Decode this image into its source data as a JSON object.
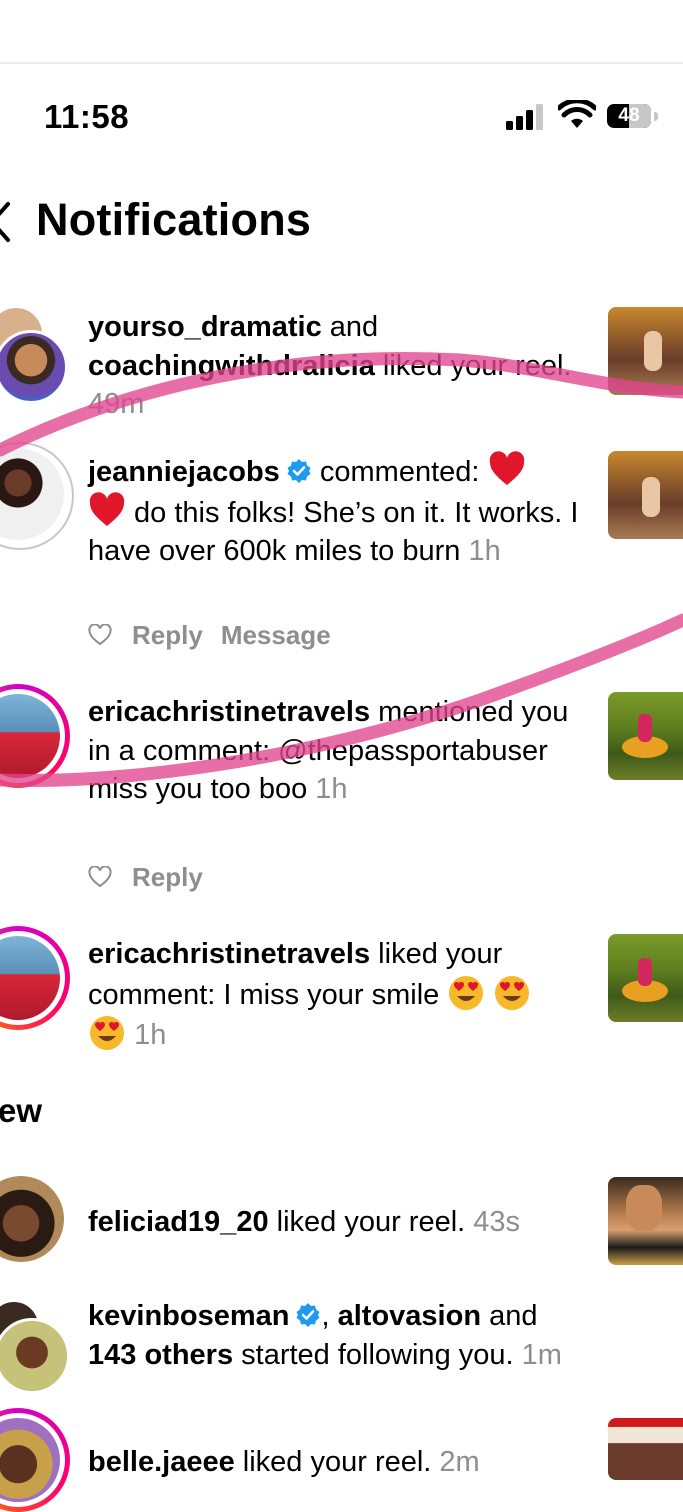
{
  "status_bar": {
    "time": "11:58",
    "battery": "48"
  },
  "header": {
    "title": "Notifications"
  },
  "notifications": [
    {
      "user1": "yourso_dramatic",
      "and": " and ",
      "user2": "coachingwithdralicia",
      "text": " liked your reel. ",
      "time": "49m"
    },
    {
      "user": "jeanniejacobs",
      "text1": " commented: ",
      "text2": " do this folks!  She’s on it. It works. I have over 600k miles to burn ",
      "time": "1h",
      "reply": "Reply",
      "message": "Message"
    },
    {
      "user": "ericachristinetravels",
      "text": " mentioned you in a comment: @thepassportabuser miss you too boo ",
      "time": "1h",
      "reply": "Reply"
    },
    {
      "user": "ericachristinetravels",
      "text": " liked your comment: I miss your smile ",
      "time": "1h"
    }
  ],
  "section_new": "ew",
  "new_notifications": [
    {
      "user": "feliciad19_20",
      "text": " liked your reel. ",
      "time": "43s"
    },
    {
      "user1": "kevinboseman",
      "sep": ", ",
      "user2": "altovasion",
      "and": " and ",
      "others": "143 others",
      "text": " started following you. ",
      "time": "1m"
    },
    {
      "user": "belle.jaeee",
      "text": " liked your reel. ",
      "time": "2m"
    }
  ],
  "colors": {
    "accent_pink": "#e2458f",
    "verified_blue": "#1d9bf0",
    "muted": "#8e8e8e"
  }
}
